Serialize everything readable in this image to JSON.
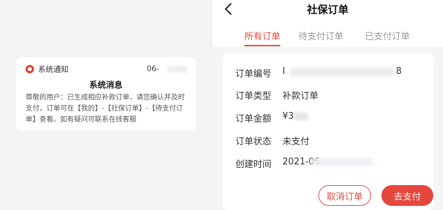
{
  "notification": {
    "app_name": "系统通知",
    "time": "06-",
    "title": "系统消息",
    "body": "尊敬的用户：已生成相应补款订单，请您确认并及时支付，订单可在【我的】-【社保订单】-【待支付订单】查看。如有疑问可联系在线客服",
    "icon": "app-logo-icon"
  },
  "orders_page": {
    "back_icon": "chevron-left-icon",
    "title": "社保订单",
    "tabs": [
      {
        "label": "所有订单",
        "active": true
      },
      {
        "label": "待支付订单",
        "active": false
      },
      {
        "label": "已支付订单",
        "active": false
      }
    ],
    "order": {
      "number_label": "订单编号",
      "number_value": "I",
      "number_tail": "8",
      "type_label": "订单类型",
      "type_value": "补款订单",
      "amount_label": "订单金额",
      "amount_value": "¥3",
      "status_label": "订单状态",
      "status_value": "未支付",
      "created_label": "创建时间",
      "created_value": "2021-06"
    },
    "cancel_button": "取消订单",
    "pay_button": "去支付"
  },
  "colors": {
    "accent": "#e14a3f",
    "background": "#f5f5f6"
  }
}
